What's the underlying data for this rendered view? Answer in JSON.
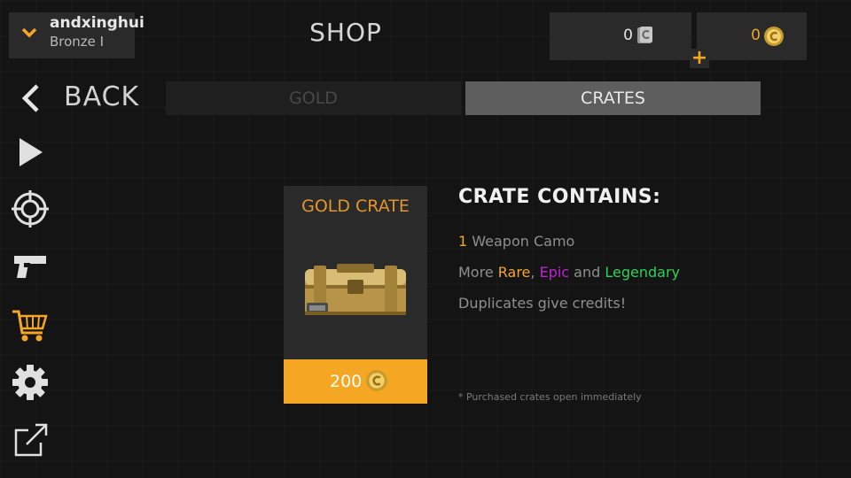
{
  "profile": {
    "username": "andxinghui",
    "rank": "Bronze I",
    "expand_icon": "chevron-down-icon"
  },
  "header": {
    "title": "SHOP"
  },
  "currency": {
    "credits": {
      "amount": "0",
      "icon": "credits-icon"
    },
    "gold": {
      "amount": "0",
      "icon": "gold-coin-icon",
      "add_label": "+"
    }
  },
  "back": {
    "label": "BACK",
    "icon": "chevron-left-icon"
  },
  "tabs": [
    {
      "label": "GOLD",
      "active": false
    },
    {
      "label": "CRATES",
      "active": true
    }
  ],
  "sidebar": {
    "items": [
      {
        "name": "play",
        "icon": "play-icon"
      },
      {
        "name": "target",
        "icon": "crosshair-icon"
      },
      {
        "name": "weapons",
        "icon": "pistol-icon"
      },
      {
        "name": "shop",
        "icon": "cart-icon",
        "active": true
      },
      {
        "name": "settings",
        "icon": "gear-icon"
      },
      {
        "name": "external",
        "icon": "external-link-icon"
      }
    ]
  },
  "crate": {
    "title": "GOLD CRATE",
    "image_icon": "gold-crate-icon",
    "price": "200",
    "price_icon": "gold-coin-icon"
  },
  "info": {
    "heading": "CRATE CONTAINS:",
    "camo_count": "1",
    "camo_text": " Weapon Camo",
    "more_text": "More ",
    "rare": "Rare",
    "comma": ", ",
    "epic": "Epic",
    "and_text": " and ",
    "legendary": "Legendary",
    "duplicates": "Duplicates give credits!",
    "footnote": "* Purchased crates open immediately"
  },
  "colors": {
    "accent": "#f5a623",
    "rare": "#f5a623",
    "epic": "#c023d6",
    "legendary": "#2fd15a",
    "panel": "#2a2a2a",
    "active_tab": "#5e5e5e"
  }
}
